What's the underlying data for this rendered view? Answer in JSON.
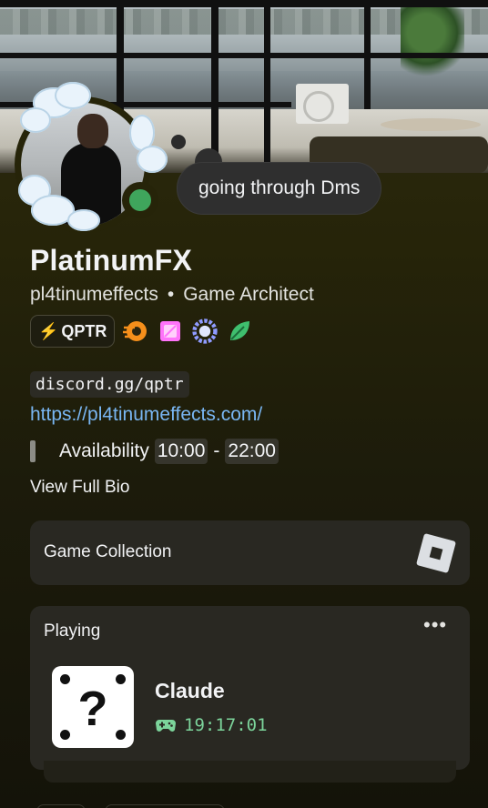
{
  "profile": {
    "display_name": "PlatinumFX",
    "username": "pl4tinumeffects",
    "separator": "•",
    "pronouns_title": "Game Architect",
    "custom_status": "going through Dms",
    "presence": "online",
    "presence_color": "#3fa55c"
  },
  "badges": {
    "server_tag_icon": "⚡",
    "server_tag": "QPTR",
    "items": [
      "hypesquad-icon",
      "nitro-icon",
      "boost-icon",
      "leaf-icon"
    ]
  },
  "bio": {
    "invite": "discord.gg/qptr",
    "website": "https://pl4tinumeffects.com/",
    "availability_label": "Availability",
    "availability_from": "10:00",
    "availability_dash": "-",
    "availability_to": "22:00",
    "view_full_bio": "View Full Bio"
  },
  "games": {
    "label": "Game Collection"
  },
  "activity": {
    "section_label": "Playing",
    "more": "•••",
    "game_title": "Claude",
    "elapsed": "19:17:01",
    "game_icon_glyph": "?"
  },
  "colors": {
    "accent_link": "#79b6f2",
    "elapsed_green": "#7cd49b",
    "card_bg": "#262409"
  }
}
